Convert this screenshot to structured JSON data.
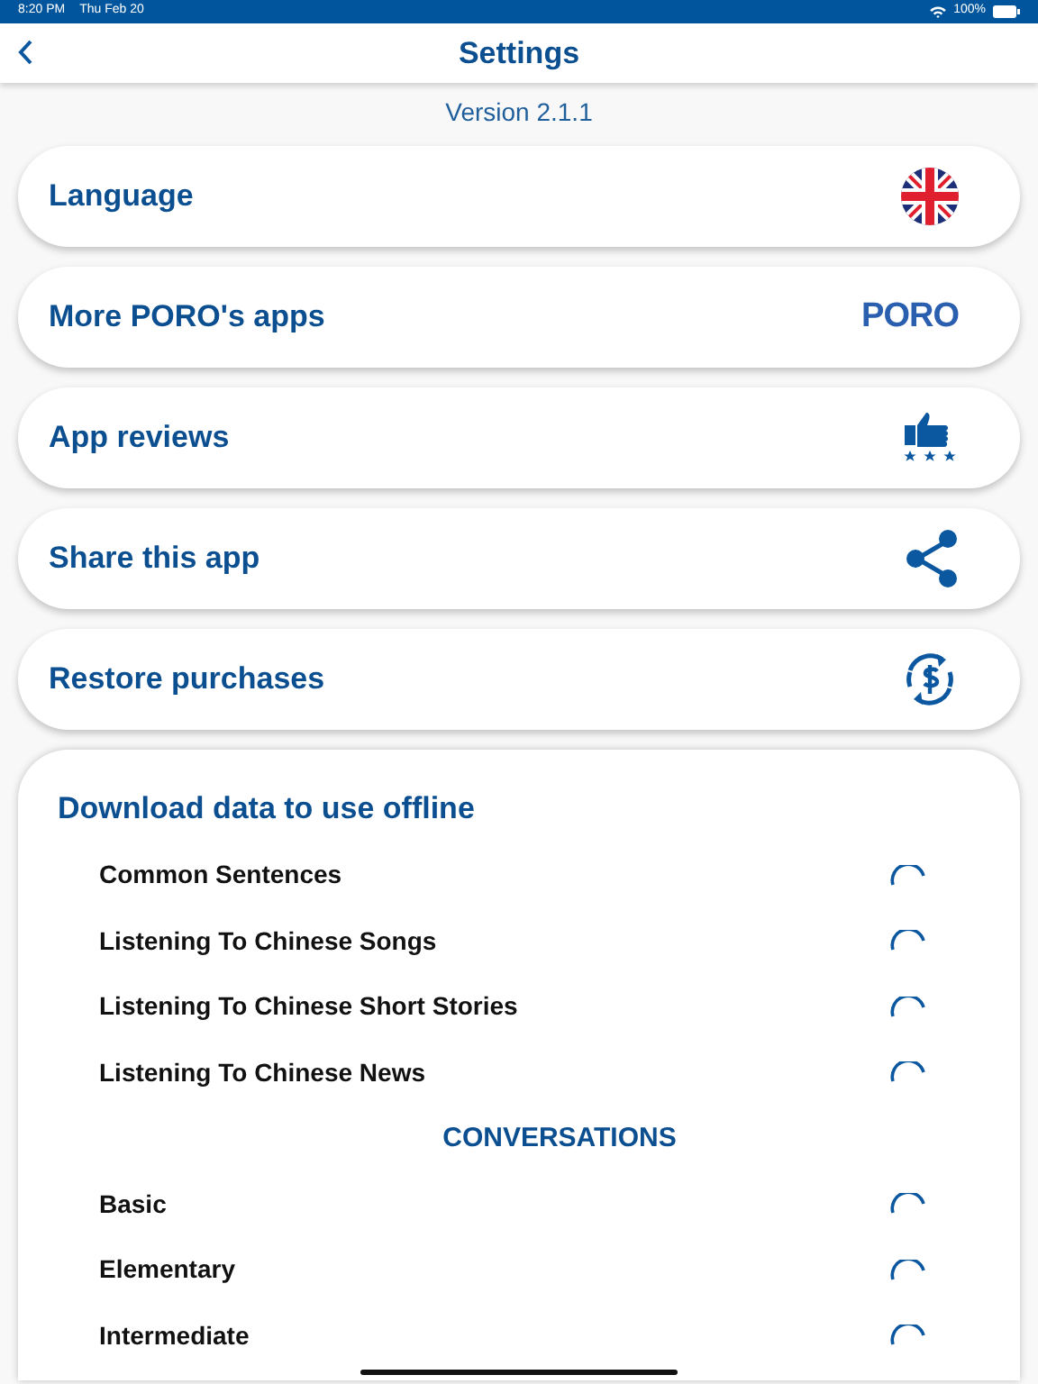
{
  "status_bar": {
    "time": "8:20 PM",
    "date": "Thu Feb 20",
    "battery": "100%"
  },
  "nav": {
    "title": "Settings"
  },
  "version": "Version 2.1.1",
  "menu": [
    {
      "label": "Language",
      "kind": "flag"
    },
    {
      "label": "More PORO's apps",
      "kind": "logo",
      "logo_text": "PORO"
    },
    {
      "label": "App reviews",
      "kind": "thumb"
    },
    {
      "label": "Share this app",
      "kind": "share"
    },
    {
      "label": "Restore purchases",
      "kind": "restore"
    }
  ],
  "download": {
    "title": "Download data to use offline",
    "rows": [
      {
        "kind": "item",
        "label": "Common Sentences"
      },
      {
        "kind": "item",
        "label": "Listening To Chinese Songs"
      },
      {
        "kind": "item",
        "label": "Listening To Chinese Short Stories"
      },
      {
        "kind": "item",
        "label": "Listening To Chinese News"
      },
      {
        "kind": "heading",
        "label": "CONVERSATIONS"
      },
      {
        "kind": "item",
        "label": "Basic"
      },
      {
        "kind": "item",
        "label": "Elementary"
      },
      {
        "kind": "item",
        "label": "Intermediate"
      }
    ]
  }
}
